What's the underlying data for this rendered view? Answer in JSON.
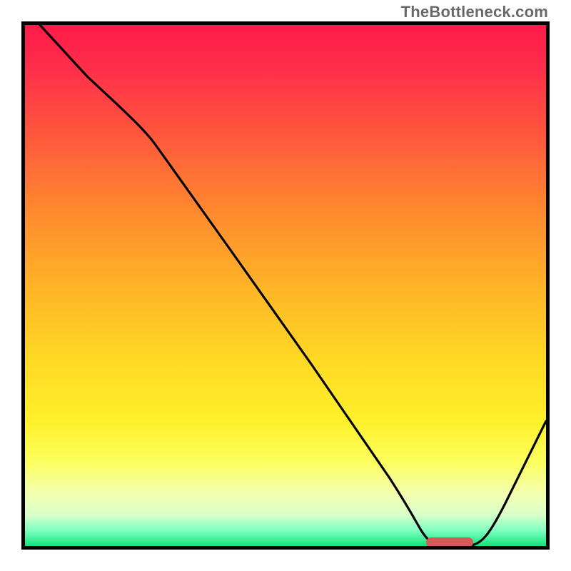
{
  "attribution": "TheBottleneck.com",
  "chart_data": {
    "type": "line",
    "title": "",
    "xlabel": "",
    "ylabel": "",
    "xlim": [
      0,
      100
    ],
    "ylim": [
      0,
      100
    ],
    "grid": false,
    "series": [
      {
        "name": "curve",
        "x": [
          3,
          12,
          25,
          40,
          55,
          70,
          76,
          80,
          85,
          92,
          100
        ],
        "y": [
          100,
          90,
          77,
          56,
          35,
          13,
          3,
          0,
          0,
          8,
          24
        ]
      }
    ],
    "marker": {
      "x_start": 77,
      "x_end": 86,
      "y": 0,
      "color": "#d65a5a"
    },
    "background_gradient": {
      "top": "#ff1a4a",
      "mid": "#ffd824",
      "bottom": "#10e47a"
    }
  }
}
